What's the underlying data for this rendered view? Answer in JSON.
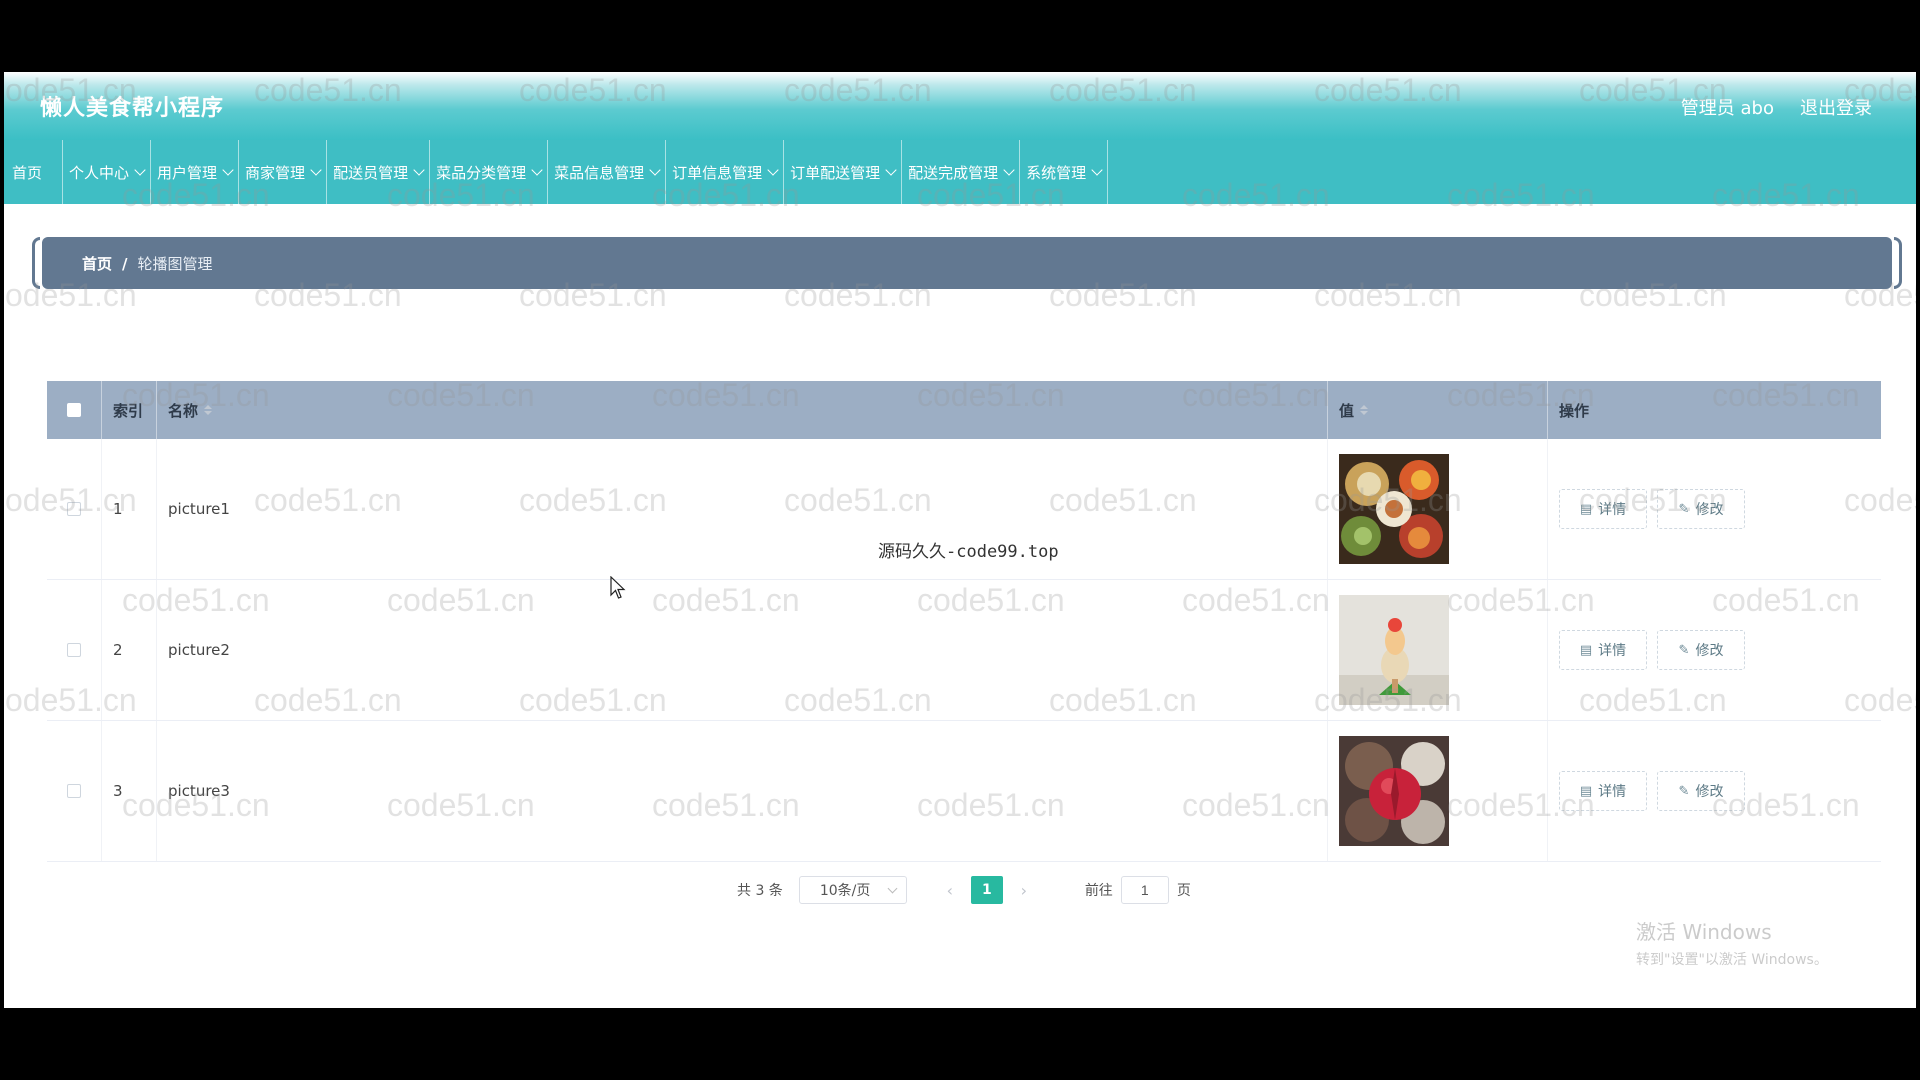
{
  "header": {
    "app_title": "懒人美食帮小程序",
    "user_label": "管理员 abo",
    "logout_label": "退出登录"
  },
  "nav": [
    {
      "label": "首页",
      "dropdown": false
    },
    {
      "label": "个人中心",
      "dropdown": true
    },
    {
      "label": "用户管理",
      "dropdown": true
    },
    {
      "label": "商家管理",
      "dropdown": true
    },
    {
      "label": "配送员管理",
      "dropdown": true
    },
    {
      "label": "菜品分类管理",
      "dropdown": true
    },
    {
      "label": "菜品信息管理",
      "dropdown": true
    },
    {
      "label": "订单信息管理",
      "dropdown": true
    },
    {
      "label": "订单配送管理",
      "dropdown": true
    },
    {
      "label": "配送完成管理",
      "dropdown": true
    },
    {
      "label": "系统管理",
      "dropdown": true
    }
  ],
  "breadcrumb": {
    "home": "首页",
    "separator": "/",
    "current": "轮播图管理"
  },
  "table": {
    "headers": {
      "index": "索引",
      "name": "名称",
      "value": "值",
      "actions": "操作"
    },
    "rows": [
      {
        "index": "1",
        "name": "picture1"
      },
      {
        "index": "2",
        "name": "picture2"
      },
      {
        "index": "3",
        "name": "picture3"
      }
    ],
    "detail_label": "详情",
    "edit_label": "修改"
  },
  "overlay_text": "源码久久-code99.top",
  "pager": {
    "total": "共 3 条",
    "page_size": "10条/页",
    "current_page": "1",
    "goto_label": "前往",
    "goto_value": "1",
    "page_unit": "页"
  },
  "watermark": "code51.cn",
  "windows_activation": {
    "line1": "激活 Windows",
    "line2": "转到\"设置\"以激活 Windows。"
  },
  "colors": {
    "nav_bg": "#3fbec4",
    "breadcrumb_bg": "#627891",
    "table_header_bg": "#9caec4",
    "pager_active": "#28b9a0"
  }
}
